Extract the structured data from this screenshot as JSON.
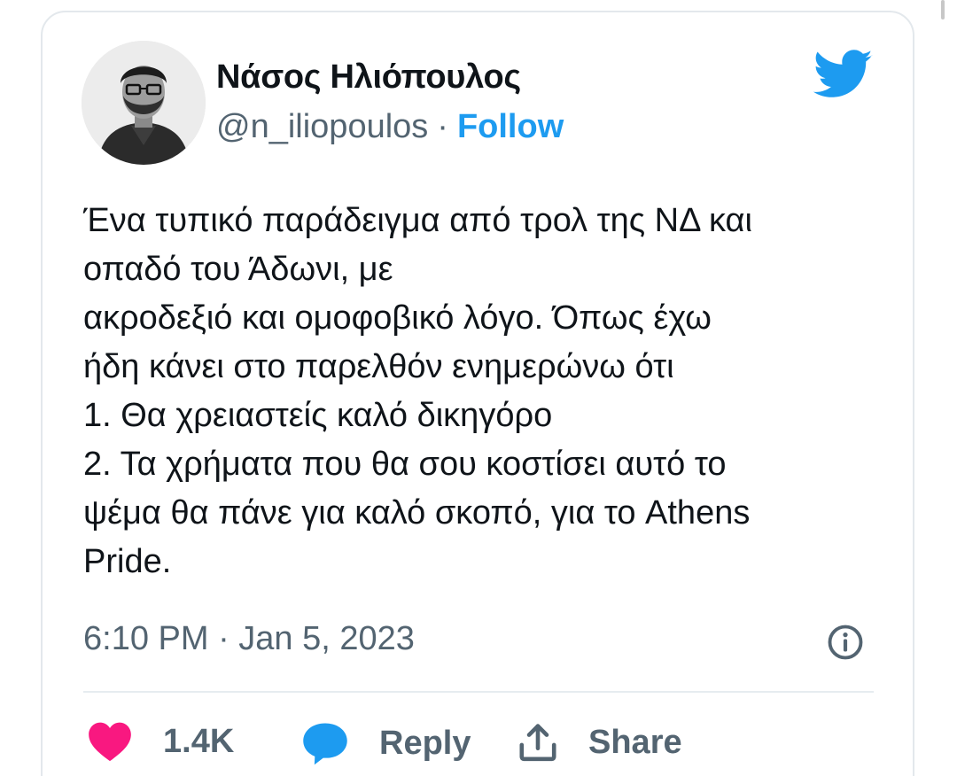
{
  "tweet": {
    "author_name": "Νάσος Ηλιόπουλος",
    "handle": "@n_iliopoulos",
    "separator": "·",
    "follow_label": "Follow",
    "body_lines": [
      "Ένα τυπικό παράδειγμα από τρολ της ΝΔ και",
      "οπαδό του Άδωνι, με",
      "ακροδεξιό και ομοφοβικό λόγο. Όπως έχω",
      "ήδη κάνει στο παρελθόν ενημερώνω ότι",
      "1. Θα χρειαστείς καλό δικηγόρο",
      "2. Τα χρήματα που θα σου κοστίσει αυτό το",
      "ψέμα θα πάνε για καλό σκοπό, για το Athens",
      "Pride."
    ],
    "timestamp": "6:10 PM · Jan 5, 2023"
  },
  "actions": {
    "like_count": "1.4K",
    "reply_label": "Reply",
    "share_label": "Share"
  },
  "icons": {
    "brand": "twitter-bird-icon",
    "like": "heart-icon",
    "reply": "speech-bubble-icon",
    "share": "share-upload-icon",
    "info": "info-icon"
  },
  "colors": {
    "accent": "#1d9bf0",
    "like": "#f91880",
    "text": "#0f1419",
    "muted": "#536471",
    "border": "#e3e8ec"
  }
}
